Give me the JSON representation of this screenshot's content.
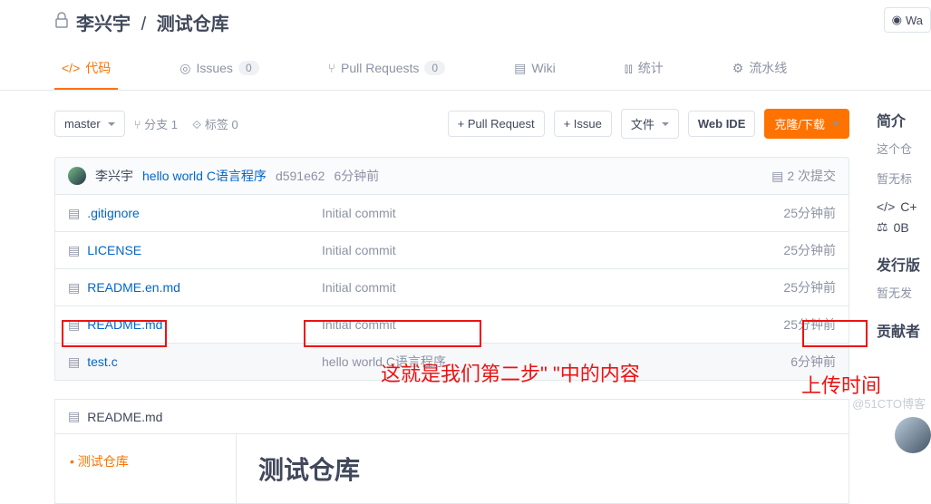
{
  "header": {
    "owner": "李兴宇",
    "repo": "测试仓库",
    "watch": "Wa"
  },
  "tabs": {
    "code": "代码",
    "issues": "Issues",
    "issues_count": "0",
    "pr": "Pull Requests",
    "pr_count": "0",
    "wiki": "Wiki",
    "stats": "统计",
    "pipeline": "流水线"
  },
  "toolbar": {
    "branch": "master",
    "branches": "分支 1",
    "tags": "标签 0",
    "pr_btn": "+ Pull Request",
    "issue_btn": "+ Issue",
    "file_btn": "文件",
    "webide": "Web IDE",
    "clone": "克隆/下载"
  },
  "commit": {
    "author": "李兴宇",
    "msg": "hello world C语言程序",
    "hash": "d591e62",
    "time": "6分钟前",
    "count": "2 次提交"
  },
  "files": [
    {
      "name": ".gitignore",
      "msg": "Initial commit",
      "time": "25分钟前"
    },
    {
      "name": "LICENSE",
      "msg": "Initial commit",
      "time": "25分钟前"
    },
    {
      "name": "README.en.md",
      "msg": "Initial commit",
      "time": "25分钟前"
    },
    {
      "name": "README.md",
      "msg": "Initial commit",
      "time": "25分钟前"
    },
    {
      "name": "test.c",
      "msg": "hello world C语言程序",
      "time": "6分钟前"
    }
  ],
  "readme": {
    "file": "README.md",
    "nav": "测试仓库",
    "title": "测试仓库"
  },
  "sidebar": {
    "intro": "简介",
    "intro_text": "这个仓",
    "no_tags": "暂无标",
    "lang": "C+",
    "size": "0B",
    "release": "发行版",
    "no_release": "暂无发",
    "contrib": "贡献者"
  },
  "annotations": {
    "a1": "这就是我们第二步\" \"中的内容",
    "a2": "上传时间"
  },
  "watermark": "@51CTO博客"
}
